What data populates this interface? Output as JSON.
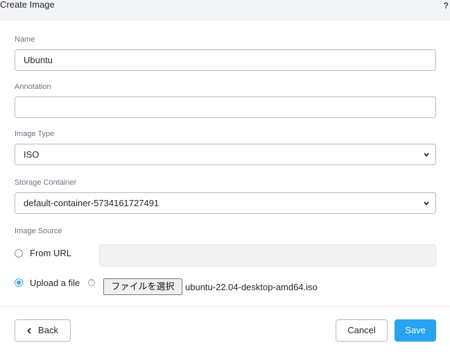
{
  "header": {
    "title": "Create Image",
    "help_glyph": "?"
  },
  "form": {
    "name": {
      "label": "Name",
      "value": "Ubuntu"
    },
    "annotation": {
      "label": "Annotation",
      "value": ""
    },
    "image_type": {
      "label": "Image Type",
      "value": "ISO"
    },
    "storage_container": {
      "label": "Storage Container",
      "value": "default-container-5734161727491"
    },
    "image_source": {
      "label": "Image Source",
      "options": [
        {
          "label": "From URL",
          "selected": false
        },
        {
          "label": "Upload a file",
          "selected": true
        }
      ],
      "url_value": "",
      "file_button_label": "ファイルを選択",
      "file_name": "ubuntu-22.04-desktop-amd64.iso"
    }
  },
  "footer": {
    "back_label": "Back",
    "cancel_label": "Cancel",
    "save_label": "Save"
  },
  "colors": {
    "accent": "#27a3f2",
    "header_bg": "#f3f4f6"
  }
}
